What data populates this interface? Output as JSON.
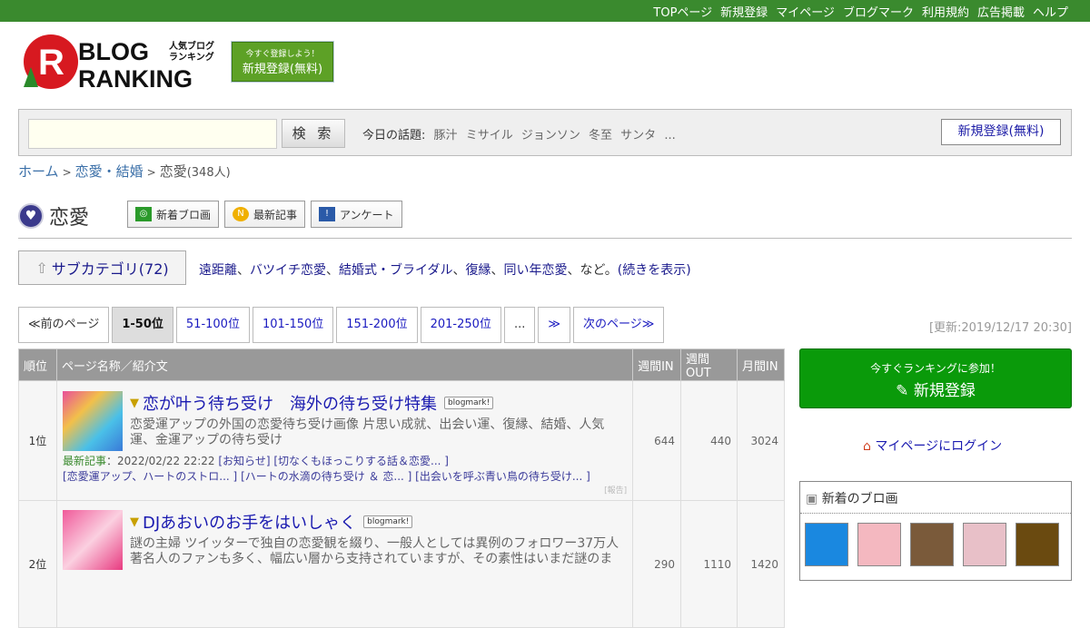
{
  "topnav": [
    "TOPページ",
    "新規登録",
    "マイページ",
    "ブログマーク",
    "利用規約",
    "広告掲載",
    "ヘルプ"
  ],
  "logo": {
    "text1": "BLOG",
    "text2": "RANKING",
    "sub": "人気ブログランキング"
  },
  "header_register": {
    "small": "今すぐ登録しよう！",
    "label": "新規登録(無料)"
  },
  "search": {
    "value": "",
    "button": "検 索",
    "topics_label": "今日の話題:",
    "topics": [
      "豚汁",
      "ミサイル",
      "ジョンソン",
      "冬至",
      "サンタ",
      "..."
    ],
    "register": "新規登録(無料)"
  },
  "breadcrumb": {
    "home": "ホーム",
    "parent": "恋愛・結婚",
    "current": "恋愛",
    "count": "(348人)"
  },
  "category": {
    "title": "恋愛",
    "buttons": [
      "新着ブロ画",
      "最新記事",
      "アンケート"
    ]
  },
  "subcategory": {
    "label": "サブカテゴリ(72)",
    "links": [
      "遠距離",
      "バツイチ恋愛",
      "結婚式・ブライダル",
      "復縁",
      "同い年恋愛"
    ],
    "suffix": "、など。",
    "more": "(続きを表示)"
  },
  "pager": [
    "≪前のページ",
    "1-50位",
    "51-100位",
    "101-150位",
    "151-200位",
    "201-250位",
    "...",
    "≫",
    "次のページ≫"
  ],
  "updated": "[更新:2019/12/17 20:30]",
  "table": {
    "headers": [
      "順位",
      "ページ名称／紹介文",
      "週間IN",
      "週間OUT",
      "月間IN"
    ],
    "rows": [
      {
        "rank": "1位",
        "title": "恋が叶う待ち受け　海外の待ち受け特集",
        "blogmark": "blogmark!",
        "desc": "恋愛運アップの外国の恋愛待ち受け画像 片思い成就、出会い運、復縁、結婚、人気運、金運アップの待ち受け",
        "latest_label": "最新記事",
        "latest_date": "：2022/02/22 22:22",
        "articles": [
          "[お知らせ]",
          "[切なくもほっこりする話＆恋愛... ]",
          "[恋愛運アップ、ハートのストロ... ]",
          "[ハートの水滴の待ち受け ＆ 恋...  ]",
          "[出会いを呼ぶ青い鳥の待ち受け... ]"
        ],
        "report": "[報告]",
        "week_in": "644",
        "week_out": "440",
        "month_in": "3024"
      },
      {
        "rank": "2位",
        "title": "DJあおいのお手をはいしゃく",
        "blogmark": "blogmark!",
        "desc": "謎の主婦 ツイッターで独自の恋愛観を綴り、一般人としては異例のフォロワー37万人著名人のファンも多く、幅広い層から支持されていますが、その素性はいまだ謎のま",
        "week_in": "290",
        "week_out": "1110",
        "month_in": "1420"
      }
    ]
  },
  "sidebar": {
    "join_small": "今すぐランキングに参加！",
    "join_label": "新規登録",
    "login": "マイページにログイン",
    "new_title": "新着のブロ画"
  }
}
